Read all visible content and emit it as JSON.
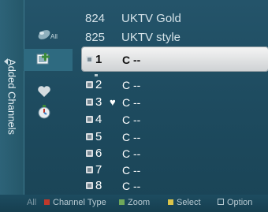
{
  "side_panel": {
    "label": "Added Channels"
  },
  "categories": [
    {
      "name": "All",
      "icon": "all-channels-icon"
    },
    {
      "name": "Added",
      "icon": "added-channel-icon"
    },
    {
      "name": "Favorite",
      "icon": "heart-icon"
    },
    {
      "name": "Programmed",
      "icon": "clock-icon"
    }
  ],
  "top_rows": [
    {
      "number": "824",
      "name": "UKTV Gold"
    },
    {
      "number": "825",
      "name": "UKTV style"
    }
  ],
  "channels": [
    {
      "number": "1",
      "name": "C --",
      "favorite": false,
      "selected": true
    },
    {
      "number": "2",
      "name": "C --",
      "favorite": false,
      "selected": false
    },
    {
      "number": "3",
      "name": "C --",
      "favorite": true,
      "selected": false
    },
    {
      "number": "4",
      "name": "C --",
      "favorite": false,
      "selected": false
    },
    {
      "number": "5",
      "name": "C --",
      "favorite": false,
      "selected": false
    },
    {
      "number": "6",
      "name": "C --",
      "favorite": false,
      "selected": false
    },
    {
      "number": "7",
      "name": "C --",
      "favorite": false,
      "selected": false
    },
    {
      "number": "8",
      "name": "C --",
      "favorite": false,
      "selected": false
    }
  ],
  "bottom_bar": {
    "all": "All",
    "channel_type": "Channel Type",
    "zoom": "Zoom",
    "select": "Select",
    "option": "Option"
  },
  "colors": {
    "background": "#1d4a5e",
    "highlight": "#e8eaeb",
    "red_button": "#c0392b",
    "green_button": "#6fa85a",
    "yellow_button": "#d9c34a",
    "blue_button": "#3d7fc4"
  }
}
